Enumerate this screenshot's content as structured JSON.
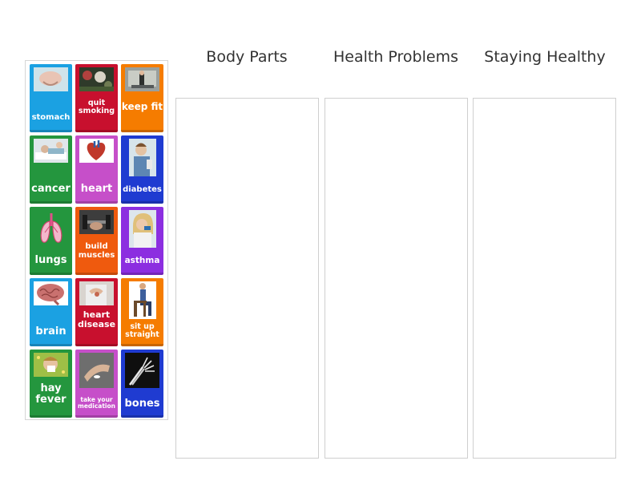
{
  "columns": [
    {
      "title": "Body Parts"
    },
    {
      "title": "Health Problems"
    },
    {
      "title": "Staying Healthy"
    }
  ],
  "cards": [
    {
      "label": "stomach",
      "color": "#1ba1e2"
    },
    {
      "label": "quit smoking",
      "color": "#c8102e"
    },
    {
      "label": "keep fit",
      "color": "#f57c00"
    },
    {
      "label": "cancer",
      "color": "#24963e"
    },
    {
      "label": "heart",
      "color": "#c64fc9"
    },
    {
      "label": "diabetes",
      "color": "#1f3bd1"
    },
    {
      "label": "lungs",
      "color": "#24963e"
    },
    {
      "label": "build muscles",
      "color": "#f57c00"
    },
    {
      "label": "asthma",
      "color": "#8c2ee0"
    },
    {
      "label": "brain",
      "color": "#1ba1e2"
    },
    {
      "label": "heart disease",
      "color": "#c8102e"
    },
    {
      "label": "sit up straight",
      "color": "#f57c00"
    },
    {
      "label": "hay fever",
      "color": "#24963e"
    },
    {
      "label": "take your medication",
      "color": "#c64fc9"
    },
    {
      "label": "bones",
      "color": "#1f3bd1"
    }
  ]
}
